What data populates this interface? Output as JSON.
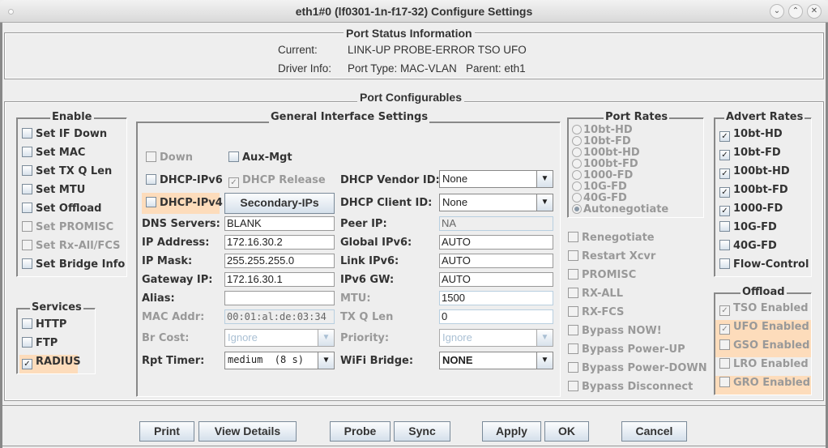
{
  "window": {
    "title": "eth1#0  (lf0301-1n-f17-32) Configure Settings",
    "minimize_icon": "chevron-down",
    "maximize_icon": "chevron-up",
    "close_icon": "x"
  },
  "status": {
    "heading": "Port Status Information",
    "current_label": "Current:",
    "current_value": "LINK-UP PROBE-ERROR TSO UFO",
    "driver_label": "Driver Info:",
    "driver_value": "Port Type: MAC-VLAN   Parent: eth1"
  },
  "configurables": {
    "heading": "Port Configurables"
  },
  "enable": {
    "title": "Enable",
    "items": [
      {
        "label": "Set IF Down",
        "checked": false,
        "disabled": false
      },
      {
        "label": "Set MAC",
        "checked": false,
        "disabled": false
      },
      {
        "label": "Set TX Q Len",
        "checked": false,
        "disabled": false
      },
      {
        "label": "Set MTU",
        "checked": false,
        "disabled": false
      },
      {
        "label": "Set Offload",
        "checked": false,
        "disabled": false
      },
      {
        "label": "Set PROMISC",
        "checked": false,
        "disabled": true
      },
      {
        "label": "Set Rx-All/FCS",
        "checked": false,
        "disabled": true
      },
      {
        "label": "Set Bridge Info",
        "checked": false,
        "disabled": false
      }
    ]
  },
  "services": {
    "title": "Services",
    "items": [
      {
        "label": "HTTP",
        "checked": false
      },
      {
        "label": "FTP",
        "checked": false
      },
      {
        "label": "RADIUS",
        "checked": true
      }
    ]
  },
  "general": {
    "title": "General Interface Settings",
    "down_label": "Down",
    "aux_mgt_label": "Aux-Mgt",
    "dhcp_ipv6_label": "DHCP-IPv6",
    "dhcp_release_label": "DHCP Release",
    "dhcp_ipv4_label": "DHCP-IPv4",
    "secondary_ips_label": "Secondary-IPs",
    "dns_servers_label": "DNS Servers:",
    "dns_servers_value": "BLANK",
    "ip_address_label": "IP Address:",
    "ip_address_value": "172.16.30.2",
    "ip_mask_label": "IP Mask:",
    "ip_mask_value": "255.255.255.0",
    "gateway_ip_label": "Gateway IP:",
    "gateway_ip_value": "172.16.30.1",
    "alias_label": "Alias:",
    "alias_value": "",
    "mac_addr_label": "MAC Addr:",
    "mac_addr_value": "00:01:al:de:03:34",
    "br_cost_label": "Br Cost:",
    "br_cost_value": "Ignore",
    "rpt_timer_label": "Rpt Timer:",
    "rpt_timer_value": "medium  (8 s)",
    "dhcp_vendor_label": "DHCP Vendor ID:",
    "dhcp_vendor_value": "None",
    "dhcp_client_label": "DHCP Client ID:",
    "dhcp_client_value": "None",
    "peer_ip_label": "Peer IP:",
    "peer_ip_value": "NA",
    "global_ipv6_label": "Global IPv6:",
    "global_ipv6_value": "AUTO",
    "link_ipv6_label": "Link IPv6:",
    "link_ipv6_value": "AUTO",
    "ipv6_gw_label": "IPv6 GW:",
    "ipv6_gw_value": "AUTO",
    "mtu_label": "MTU:",
    "mtu_value": "1500",
    "txqlen_label": "TX Q Len",
    "txqlen_value": "0",
    "priority_label": "Priority:",
    "priority_value": "Ignore",
    "wifi_bridge_label": "WiFi Bridge:",
    "wifi_bridge_value": "NONE"
  },
  "port_rates": {
    "title": "Port Rates",
    "options": [
      "10bt-HD",
      "10bt-FD",
      "100bt-HD",
      "100bt-FD",
      "1000-FD",
      "10G-FD",
      "40G-FD",
      "Autonegotiate"
    ],
    "selected": "Autonegotiate"
  },
  "misc": {
    "items": [
      "Renegotiate",
      "Restart Xcvr",
      "PROMISC",
      "RX-ALL",
      "RX-FCS",
      "Bypass NOW!",
      "Bypass Power-UP",
      "Bypass Power-DOWN",
      "Bypass Disconnect"
    ]
  },
  "advert_rates": {
    "title": "Advert Rates",
    "items": [
      {
        "label": "10bt-HD",
        "checked": true
      },
      {
        "label": "10bt-FD",
        "checked": true
      },
      {
        "label": "100bt-HD",
        "checked": true
      },
      {
        "label": "100bt-FD",
        "checked": true
      },
      {
        "label": "1000-FD",
        "checked": true
      },
      {
        "label": "10G-FD",
        "checked": false
      },
      {
        "label": "40G-FD",
        "checked": false
      },
      {
        "label": "Flow-Control",
        "checked": false
      }
    ]
  },
  "offload": {
    "title": "Offload",
    "items": [
      {
        "label": "TSO Enabled",
        "checked": true,
        "highlight": false
      },
      {
        "label": "UFO Enabled",
        "checked": true,
        "highlight": true
      },
      {
        "label": "GSO Enabled",
        "checked": false,
        "highlight": true
      },
      {
        "label": "LRO Enabled",
        "checked": false,
        "highlight": false
      },
      {
        "label": "GRO Enabled",
        "checked": false,
        "highlight": true
      }
    ]
  },
  "buttons": {
    "print": "Print",
    "view_details": "View Details",
    "probe": "Probe",
    "sync": "Sync",
    "apply": "Apply",
    "ok": "OK",
    "cancel": "Cancel"
  },
  "colors": {
    "highlight": "#fddcbb",
    "background": "#eeeeee"
  }
}
